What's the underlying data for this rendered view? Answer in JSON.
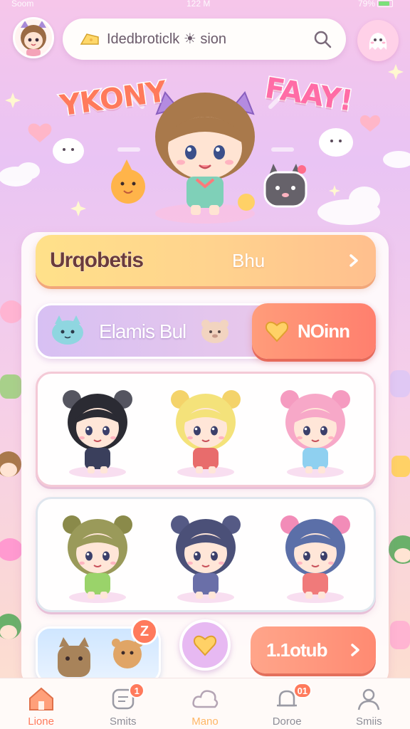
{
  "status_bar": {
    "carrier": "Soom",
    "time": "122 M",
    "battery": "79%"
  },
  "header": {
    "search_placeholder": "Idedbroticlk ☀ sion"
  },
  "hero": {
    "title_left": "YKONY",
    "title_right": "FAAY!"
  },
  "upgrade_banner": {
    "title": "Urqobetis",
    "subtitle": "Bhu"
  },
  "promo": {
    "label": "Elamis Bul",
    "button_label": "NOinn"
  },
  "characters": {
    "row1": [
      {
        "name": "black-hair-cat-girl",
        "hair": "#2b2b33",
        "ear": "#555560",
        "outfit": "#3a3f5c"
      },
      {
        "name": "blonde-bear-girl",
        "hair": "#f4e27a",
        "ear": "#f4d36a",
        "outfit": "#e86c6c"
      },
      {
        "name": "pink-cat-girl",
        "hair": "#f7a8c8",
        "ear": "#f59bc0",
        "outfit": "#8fd0f0"
      }
    ],
    "row2": [
      {
        "name": "green-hair-girl",
        "hair": "#9a9a5a",
        "ear": "#8a8a4a",
        "outfit": "#9ad36a"
      },
      {
        "name": "navy-bear-girl",
        "hair": "#4b5078",
        "ear": "#555a85",
        "outfit": "#6a6fa8"
      },
      {
        "name": "blue-cat-girl",
        "hair": "#5b6fa8",
        "ear": "#f28cb8",
        "outfit": "#f07a7a"
      }
    ]
  },
  "bottom_actions": {
    "badge": "Z",
    "action_label": "1.1otub"
  },
  "tabs": [
    {
      "label": "Lione",
      "icon": "home-icon",
      "active": true,
      "badge": ""
    },
    {
      "label": "Smits",
      "icon": "chat-icon",
      "active": false,
      "badge": "1"
    },
    {
      "label": "Mano",
      "icon": "cloud-icon",
      "active": false,
      "badge": ""
    },
    {
      "label": "Doroe",
      "icon": "bell-icon",
      "active": false,
      "badge": "01"
    },
    {
      "label": "Smiis",
      "icon": "profile-icon",
      "active": false,
      "badge": ""
    }
  ],
  "colors": {
    "accent": "#ff7a5c",
    "panel": "#fffcfc",
    "banner": "#ffd28e",
    "promo": "#d7c0f3"
  }
}
